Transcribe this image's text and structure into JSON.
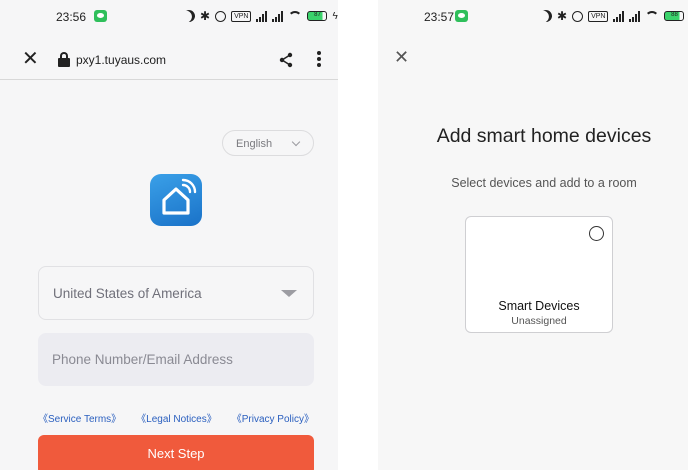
{
  "left_screen": {
    "status_time": "23:56",
    "status_icons": [
      "moon-icon",
      "bluetooth-icon",
      "alarm-icon",
      "vpn-icon",
      "signal-icon",
      "signal-icon",
      "wifi-icon",
      "battery-icon",
      "charging-icon"
    ],
    "battery_text": "87",
    "browser": {
      "url": "pxy1.tuyaus.com",
      "close_icon": "close-icon",
      "share_icon": "share-icon",
      "menu_icon": "more-vert-icon"
    },
    "language_label": "English",
    "app_icon": "smart-home-app-icon",
    "country_value": "United States of America",
    "account_placeholder": "Phone Number/Email Address",
    "links": {
      "service_terms": "《Service Terms》",
      "legal_notices": "《Legal Notices》",
      "privacy_policy": "《Privacy Policy》"
    },
    "next_button": "Next Step",
    "colors": {
      "accent": "#f05a3c",
      "link": "#2a5fbf",
      "app_icon": "#2a8ad8"
    }
  },
  "right_screen": {
    "status_time": "23:57",
    "battery_text": "88",
    "title": "Add smart home devices",
    "subtitle": "Select devices and add to a room",
    "device_card": {
      "name": "Smart Devices",
      "room": "Unassigned",
      "selected": false
    }
  }
}
